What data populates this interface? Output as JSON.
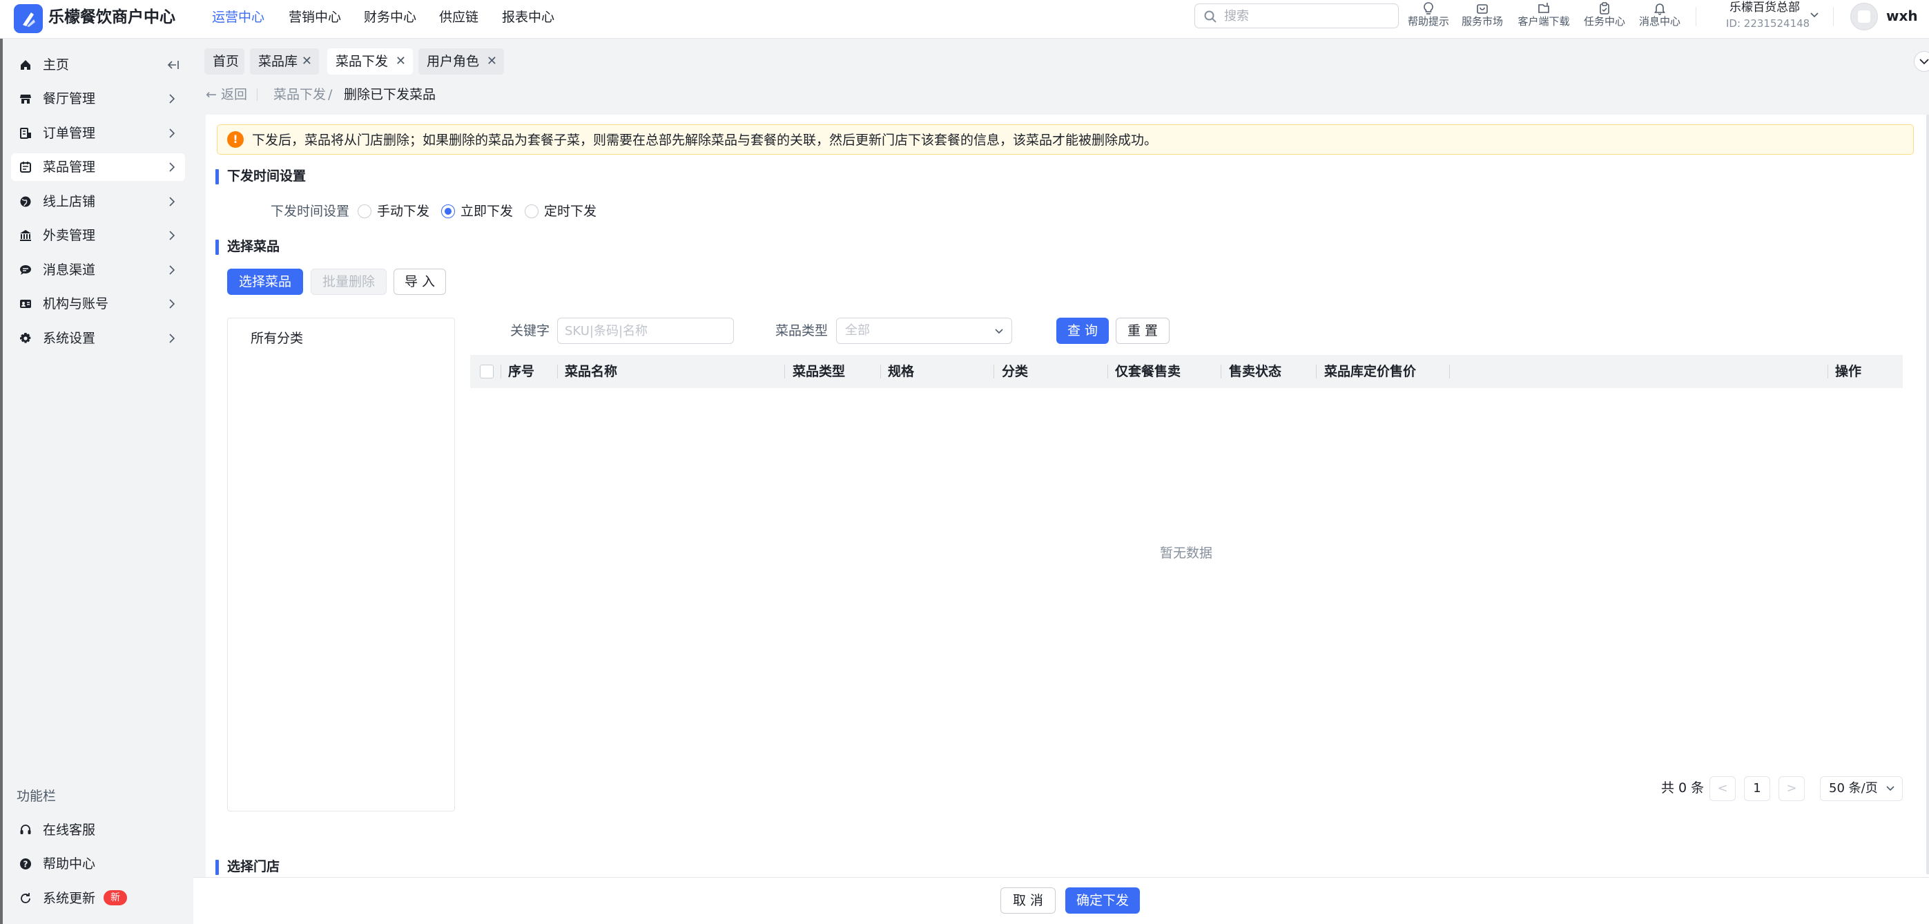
{
  "app": {
    "name": "乐檬餐饮商户中心"
  },
  "topnav": [
    {
      "label": "运营中心",
      "active": true
    },
    {
      "label": "营销中心",
      "active": false
    },
    {
      "label": "财务中心",
      "active": false
    },
    {
      "label": "供应链",
      "active": false
    },
    {
      "label": "报表中心",
      "active": false
    }
  ],
  "search": {
    "placeholder": "搜索"
  },
  "tools": [
    {
      "label": "帮助提示",
      "icon": "lightbulb-icon"
    },
    {
      "label": "服务市场",
      "icon": "store-icon"
    },
    {
      "label": "客户端下载",
      "icon": "download-icon"
    },
    {
      "label": "任务中心",
      "icon": "clipboard-icon"
    },
    {
      "label": "消息中心",
      "icon": "bell-icon"
    }
  ],
  "org": {
    "name": "乐檬百货总部",
    "id": "ID: 2231524148"
  },
  "user": {
    "name": "wxh"
  },
  "sidebar": {
    "items": [
      {
        "label": "主页",
        "icon": "home-icon",
        "active": false
      },
      {
        "label": "餐厅管理",
        "icon": "shop-icon",
        "active": false
      },
      {
        "label": "订单管理",
        "icon": "order-icon",
        "active": false
      },
      {
        "label": "菜品管理",
        "icon": "dish-icon",
        "active": true
      },
      {
        "label": "线上店铺",
        "icon": "globe-icon",
        "active": false
      },
      {
        "label": "外卖管理",
        "icon": "bank-icon",
        "active": false
      },
      {
        "label": "消息渠道",
        "icon": "message-icon",
        "active": false
      },
      {
        "label": "机构与账号",
        "icon": "account-icon",
        "active": false
      },
      {
        "label": "系统设置",
        "icon": "gear-icon",
        "active": false
      }
    ],
    "func_title": "功能栏",
    "func_items": [
      {
        "label": "在线客服",
        "icon": "headset-icon"
      },
      {
        "label": "帮助中心",
        "icon": "help-icon"
      },
      {
        "label": "系统更新",
        "icon": "refresh-icon",
        "badge": "新"
      }
    ]
  },
  "tabs": [
    {
      "label": "首页",
      "closable": false,
      "active": false
    },
    {
      "label": "菜品库",
      "closable": true,
      "active": false
    },
    {
      "label": "菜品下发",
      "closable": true,
      "active": true
    },
    {
      "label": "用户角色",
      "closable": true,
      "active": false
    }
  ],
  "breadcrumb": {
    "back": "返回",
    "items": [
      "菜品下发",
      "删除已下发菜品"
    ],
    "separator": "/"
  },
  "notice": {
    "icon": "!",
    "text": "下发后，菜品将从门店删除；如果删除的菜品为套餐子菜，则需要在总部先解除菜品与套餐的关联，然后更新门店下该套餐的信息，该菜品才能被删除成功。"
  },
  "time_section": {
    "title": "下发时间设置",
    "field_label": "下发时间设置",
    "options": [
      "手动下发",
      "立即下发",
      "定时下发"
    ],
    "selected": "立即下发"
  },
  "dish_section": {
    "title": "选择菜品",
    "buttons": {
      "select": "选择菜品",
      "batch_delete": "批量删除",
      "import": "导 入"
    },
    "category_all": "所有分类",
    "filters": {
      "keyword_label": "关键字",
      "keyword_placeholder": "SKU|条码|名称",
      "type_label": "菜品类型",
      "type_value": "全部",
      "query": "查 询",
      "reset": "重 置"
    },
    "table": {
      "columns": [
        "序号",
        "菜品名称",
        "菜品类型",
        "规格",
        "分类",
        "仅套餐售卖",
        "售卖状态",
        "菜品库定价售价",
        "操作"
      ],
      "rows": [],
      "empty_text": "暂无数据"
    },
    "pagination": {
      "total": "共 0 条",
      "page": "1",
      "page_size": "50 条/页"
    }
  },
  "store_section": {
    "title": "选择门店"
  },
  "footer": {
    "cancel": "取 消",
    "confirm": "确定下发"
  },
  "colors": {
    "primary": "#3b6cf5",
    "warning": "#ff7d00",
    "notice_bg": "#fffbe8",
    "badge": "#f53f3f"
  }
}
